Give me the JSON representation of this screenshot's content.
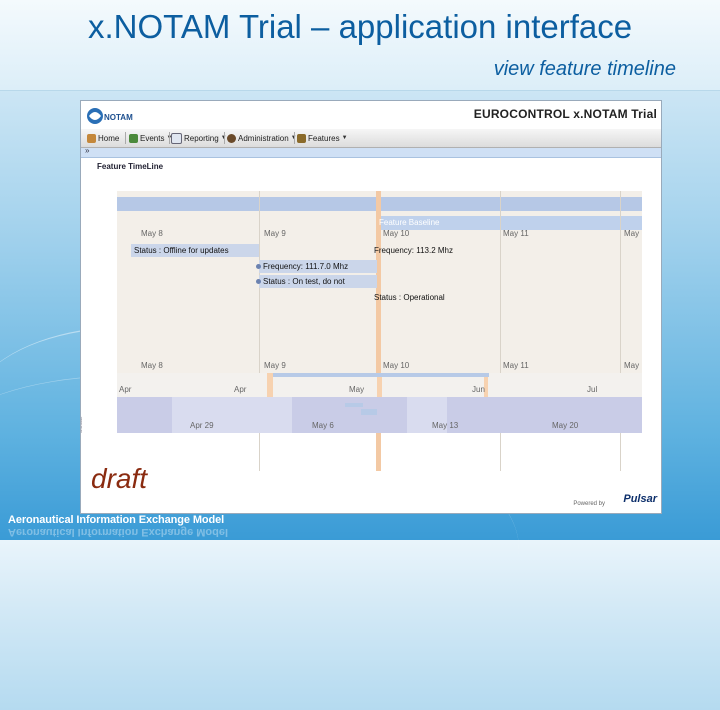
{
  "slide": {
    "title": "x.NOTAM Trial – application interface",
    "subtitle": "view feature timeline",
    "footer": "Aeronautical Information Exchange Model"
  },
  "app": {
    "logo_text": "NOTAM",
    "title": "EUROCONTROL x.NOTAM Trial",
    "toolbar": [
      {
        "label": "Home",
        "icon": "home-icon",
        "has_menu": false
      },
      {
        "label": "Events",
        "icon": "events-icon",
        "has_menu": true
      },
      {
        "label": "Reporting",
        "icon": "document-icon",
        "has_menu": true
      },
      {
        "label": "Administration",
        "icon": "admin-icon",
        "has_menu": true
      },
      {
        "label": "Features",
        "icon": "features-icon",
        "has_menu": true
      }
    ],
    "collapse_symbol": "»",
    "panel_title": "Feature TimeLine",
    "timeline": {
      "baseline_label": "Feature Baseline",
      "top_dates": [
        "May 8",
        "May 9",
        "May 10",
        "May 11",
        "May"
      ],
      "bottom_dates": [
        "May 8",
        "May 9",
        "May 10",
        "May 11",
        "May"
      ],
      "events": {
        "status_offline": "Status : Offline for updates",
        "frequency_old": "Frequency: 111.7.0 Mhz",
        "status_test": "Status : On test, do not",
        "frequency_new": "Frequency: 113.2 Mhz",
        "status_operational": "Status : Operational"
      },
      "overview_months": [
        "Apr",
        "Apr",
        "May",
        "Jun",
        "Jul"
      ],
      "overview_weeks": [
        "Apr 29",
        "May 6",
        "May 13",
        "May 20"
      ],
      "side_label": "SIMILE"
    },
    "draft_label": "draft",
    "powered_by": "Powered by",
    "powered_brand": "Pulsar"
  },
  "colors": {
    "title": "#0c5ea0",
    "baseline": "#f3c9a4",
    "band": "#b6c8e6",
    "draft": "#8a2b10"
  }
}
